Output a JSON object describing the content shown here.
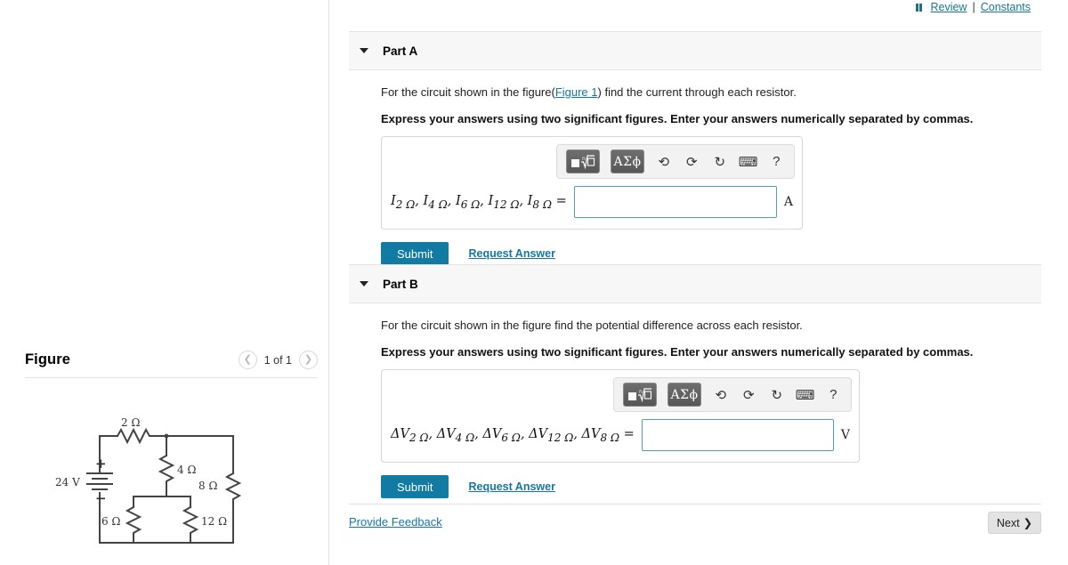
{
  "topbar": {
    "icon": "panels-icon",
    "review_label": "Review",
    "separator": "|",
    "constants_label": "Constants"
  },
  "figure_pane": {
    "title": "Figure",
    "prev_icon": "chevron-left-icon",
    "next_icon": "chevron-right-icon",
    "counter": "1 of 1",
    "circuit": {
      "source_label": "24 V",
      "plus_sign": "+",
      "minus_sign": "−",
      "resistors": [
        {
          "name": "r2",
          "label": "2 Ω"
        },
        {
          "name": "r4",
          "label": "4 Ω"
        },
        {
          "name": "r8",
          "label": "8 Ω"
        },
        {
          "name": "r6",
          "label": "6 Ω"
        },
        {
          "name": "r12",
          "label": "12 Ω"
        }
      ]
    }
  },
  "parts": [
    {
      "id": "part-a",
      "caret_icon": "caret-down-icon",
      "label": "Part A",
      "prompt_before": "For the circuit shown in the figure(",
      "prompt_link": "Figure 1",
      "prompt_after": ") find the current through each resistor.",
      "instruction": "Express your answers using two significant figures. Enter your answers numerically separated by commas.",
      "answer_label_html": "I<sub>2 Ω</sub>, I<sub>4 Ω</sub>, I<sub>6 Ω</sub>, I<sub>12 Ω</sub>, I<sub>8 Ω</sub> =",
      "answer_value": "",
      "answer_placeholder": "",
      "unit": "A",
      "submit_label": "Submit",
      "request_answer_label": "Request Answer",
      "toolbar": {
        "template_button": "math-template-button",
        "greek_button": "ΑΣϕ",
        "undo_icon": "undo-icon",
        "redo_icon": "redo-icon",
        "reset_icon": "reset-icon",
        "keyboard_icon": "keyboard-icon",
        "help_icon": "?"
      }
    },
    {
      "id": "part-b",
      "caret_icon": "caret-down-icon",
      "label": "Part B",
      "prompt_before": "For the circuit shown in the figure find the potential difference across each resistor.",
      "prompt_link": "",
      "prompt_after": "",
      "instruction": "Express your answers using two significant figures. Enter your answers numerically separated by commas.",
      "answer_label_html": "ΔV<sub>2 Ω</sub>, ΔV<sub>4 Ω</sub>, ΔV<sub>6 Ω</sub>, ΔV<sub>12 Ω</sub>, ΔV<sub>8 Ω</sub> =",
      "answer_value": "",
      "answer_placeholder": "",
      "unit": "V",
      "submit_label": "Submit",
      "request_answer_label": "Request Answer",
      "toolbar": {
        "template_button": "math-template-button",
        "greek_button": "ΑΣϕ",
        "undo_icon": "undo-icon",
        "redo_icon": "redo-icon",
        "reset_icon": "reset-icon",
        "keyboard_icon": "keyboard-icon",
        "help_icon": "?"
      }
    }
  ],
  "footer": {
    "feedback_label": "Provide Feedback",
    "next_label": "Next",
    "next_icon": "chevron-right-icon"
  },
  "colors": {
    "accent": "#127ba3",
    "link": "#1577a6",
    "input_border": "#4e9fc0",
    "header_bg": "#f7f7f7"
  }
}
